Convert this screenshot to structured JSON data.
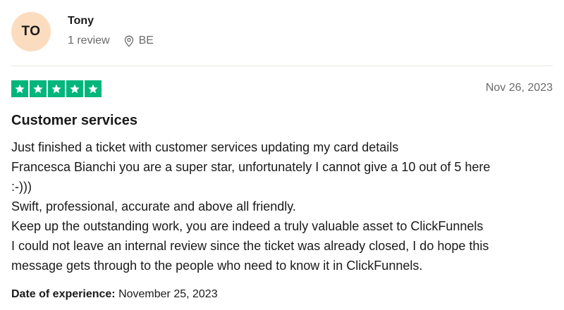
{
  "reviewer": {
    "initials": "TO",
    "name": "Tony",
    "review_count": "1 review",
    "location": "BE",
    "location_icon": "location-pin-icon",
    "avatar_color": "#fcdcbf"
  },
  "review": {
    "rating": 5,
    "rating_max": 5,
    "star_color": "#00b67a",
    "date": "Nov 26, 2023",
    "title": "Customer services",
    "body_lines": [
      "Just finished a ticket with customer services updating my card details",
      "Francesca Bianchi you are a super star, unfortunately I cannot give a 10 out of 5 here",
      ":-)))",
      "Swift, professional, accurate and above all friendly.",
      "Keep up the outstanding work, you are indeed a truly valuable asset to ClickFunnels",
      "I could not leave an internal review since the ticket was already closed, I do hope this",
      "message gets through to the people who need to know it in ClickFunnels."
    ],
    "experience_label": "Date of experience:",
    "experience_date": "November 25, 2023"
  }
}
